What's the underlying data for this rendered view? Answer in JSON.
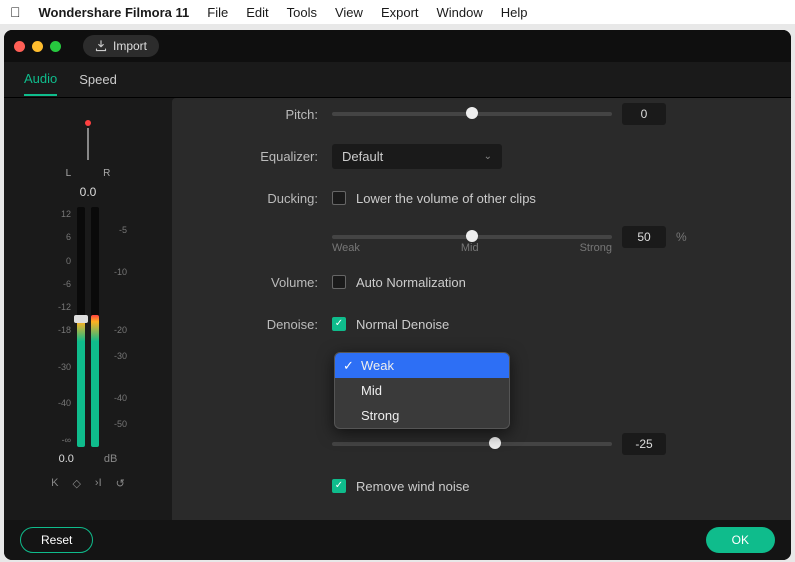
{
  "menubar": {
    "appname": "Wondershare Filmora 11",
    "items": [
      "File",
      "Edit",
      "Tools",
      "View",
      "Export",
      "Window",
      "Help"
    ]
  },
  "titlebar": {
    "import": "Import"
  },
  "tabs": {
    "audio": "Audio",
    "speed": "Speed"
  },
  "meter": {
    "L": "L",
    "R": "R",
    "pan": "0.0",
    "scale": [
      "12",
      "6",
      "0",
      "-6",
      "-12",
      "-18",
      "",
      "-30",
      "",
      "-40",
      "",
      "-∞"
    ],
    "scale2": [
      "",
      "-5",
      "",
      "-10",
      "",
      "",
      "-20",
      "-30",
      "",
      "-40",
      "-50",
      ""
    ],
    "db_val": "0.0",
    "db_lbl": "dB"
  },
  "controls": {
    "pitch_label": "Pitch:",
    "pitch_val": "0",
    "eq_label": "Equalizer:",
    "eq_val": "Default",
    "duck_label": "Ducking:",
    "duck_cb": "Lower the volume of other clips",
    "duck_val": "50",
    "pct": "%",
    "tick_weak": "Weak",
    "tick_mid": "Mid",
    "tick_strong": "Strong",
    "vol_label": "Volume:",
    "vol_cb": "Auto Normalization",
    "denoise_label": "Denoise:",
    "denoise_cb": "Normal Denoise",
    "denoise_opts": [
      "Weak",
      "Mid",
      "Strong"
    ],
    "slider2_val": "-25",
    "wind_cb": "Remove wind noise"
  },
  "footer": {
    "reset": "Reset",
    "ok": "OK"
  }
}
